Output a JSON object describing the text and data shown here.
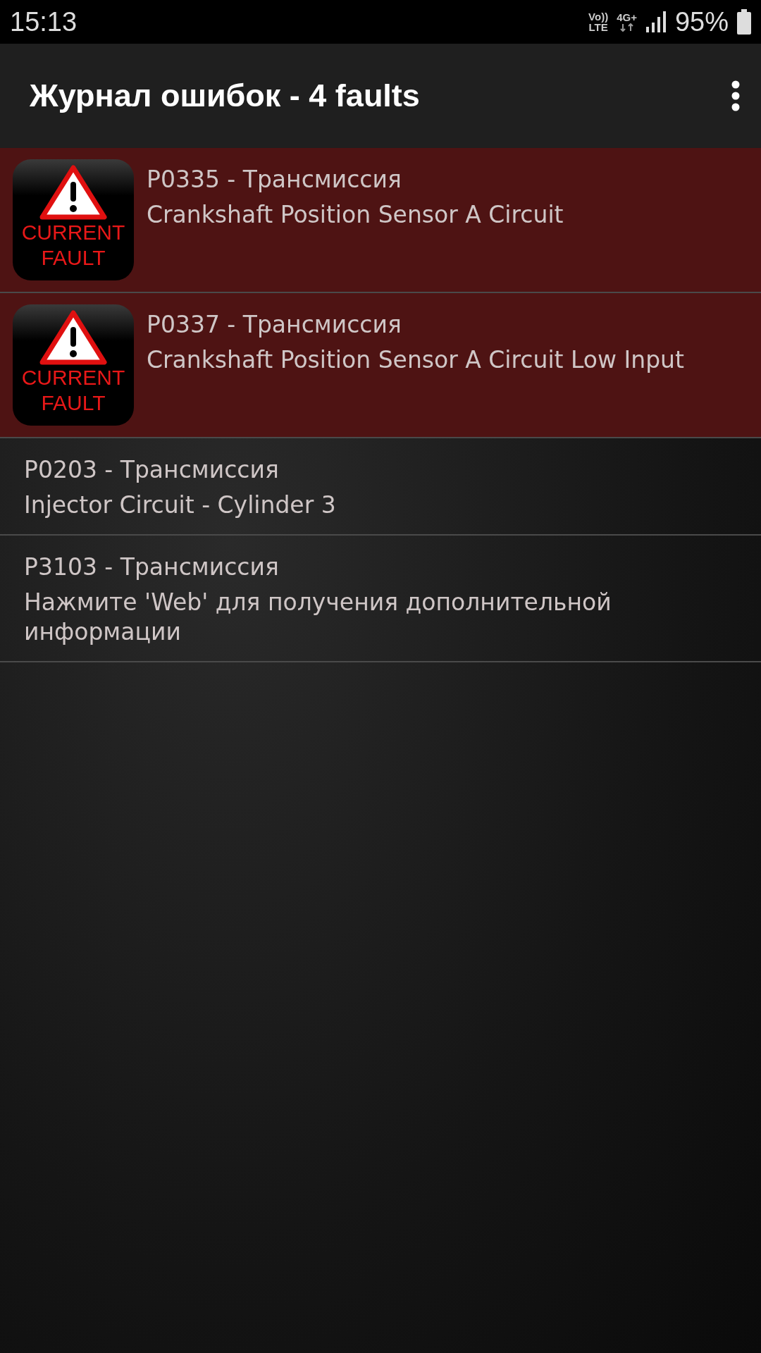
{
  "status_bar": {
    "time": "15:13",
    "volte_top": "Vo))",
    "volte_bottom": "LTE",
    "network": "4G+",
    "battery": "95%"
  },
  "app_bar": {
    "title": "Журнал ошибок - 4 faults"
  },
  "faults": [
    {
      "kind": "current",
      "badge": [
        "CURRENT",
        "FAULT"
      ],
      "code": "P0335 - Трансмиссия",
      "description": "Crankshaft Position Sensor A Circuit"
    },
    {
      "kind": "current",
      "badge": [
        "CURRENT",
        "FAULT"
      ],
      "code": "P0337 - Трансмиссия",
      "description": "Crankshaft Position Sensor A Circuit Low Input"
    },
    {
      "kind": "stored",
      "code": "P0203 - Трансмиссия",
      "description": "Injector Circuit - Cylinder 3"
    },
    {
      "kind": "stored",
      "code": "P3103 - Трансмиссия",
      "description": "Нажмите 'Web' для получения дополнительной информации"
    }
  ]
}
